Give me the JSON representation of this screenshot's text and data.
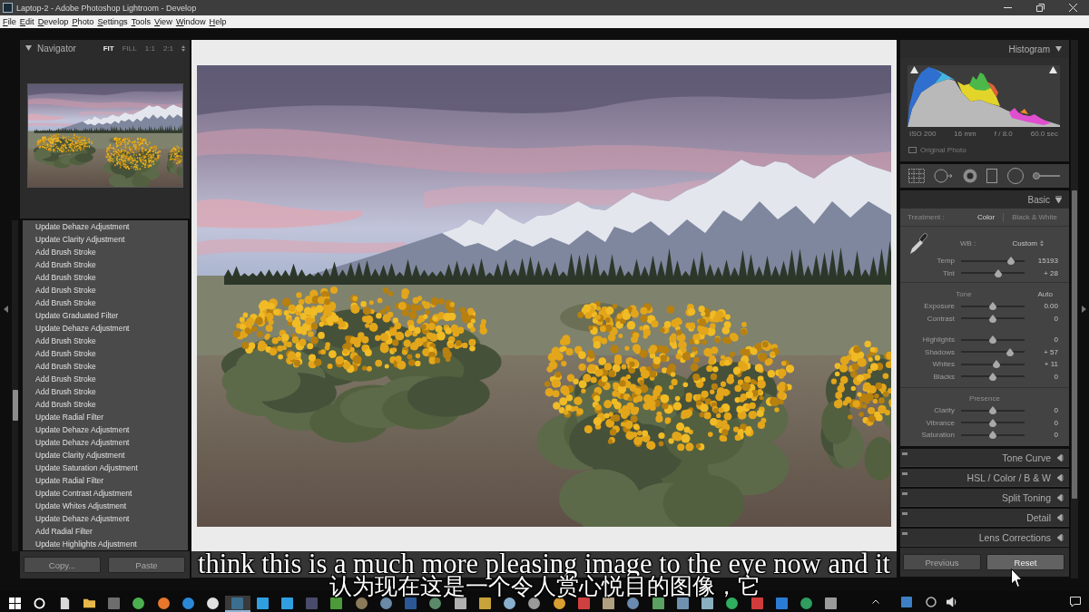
{
  "window": {
    "title": "Laptop-2 - Adobe Photoshop Lightroom - Develop"
  },
  "menu": [
    "File",
    "Edit",
    "Develop",
    "Photo",
    "Settings",
    "Tools",
    "View",
    "Window",
    "Help"
  ],
  "navigator": {
    "title": "Navigator",
    "zoom_options": [
      {
        "label": "FIT",
        "selected": true
      },
      {
        "label": "FILL",
        "selected": false
      },
      {
        "label": "1:1",
        "selected": false
      },
      {
        "label": "2:1",
        "selected": false
      }
    ]
  },
  "history": {
    "items": [
      "Update Dehaze Adjustment",
      "Update Clarity Adjustment",
      "Add Brush Stroke",
      "Add Brush Stroke",
      "Add Brush Stroke",
      "Add Brush Stroke",
      "Add Brush Stroke",
      "Update Graduated Filter",
      "Update Dehaze Adjustment",
      "Add Brush Stroke",
      "Add Brush Stroke",
      "Add Brush Stroke",
      "Add Brush Stroke",
      "Add Brush Stroke",
      "Add Brush Stroke",
      "Update Radial Filter",
      "Update Dehaze Adjustment",
      "Update Dehaze Adjustment",
      "Update Clarity Adjustment",
      "Update Saturation Adjustment",
      "Update Radial Filter",
      "Update Contrast Adjustment",
      "Update Whites Adjustment",
      "Update Dehaze Adjustment",
      "Add Radial Filter",
      "Update Highlights Adjustment"
    ]
  },
  "left_buttons": [
    "Copy...",
    "Paste"
  ],
  "histogram": {
    "title": "Histogram",
    "exif": [
      "ISO 200",
      "16 mm",
      "f / 8.0",
      "60.0 sec"
    ],
    "original_photo": {
      "label": "Original Photo",
      "checked": false
    }
  },
  "basic": {
    "title": "Basic",
    "treatment": {
      "label": "Treatment :",
      "options": [
        {
          "label": "Color",
          "selected": true
        },
        {
          "label": "Black & White",
          "selected": false
        }
      ]
    },
    "wb": {
      "label": "WB :",
      "value": "Custom"
    },
    "wb_sliders": [
      {
        "name": "Temp",
        "level": 0.78,
        "reading": "15193"
      },
      {
        "name": "Tint",
        "level": 0.59,
        "reading": "+ 28"
      }
    ],
    "tone": {
      "title": "Tone",
      "auto": "Auto",
      "groups": [
        [
          {
            "name": "Exposure",
            "level": 0.5,
            "reading": "0.00"
          },
          {
            "name": "Contrast",
            "level": 0.5,
            "reading": "0"
          }
        ],
        [
          {
            "name": "Highlights",
            "level": 0.5,
            "reading": "0"
          },
          {
            "name": "Shadows",
            "level": 0.77,
            "reading": "+ 57"
          },
          {
            "name": "Whites",
            "level": 0.55,
            "reading": "+ 11"
          },
          {
            "name": "Blacks",
            "level": 0.5,
            "reading": "0"
          }
        ]
      ]
    },
    "presence": {
      "title": "Presence",
      "sliders": [
        {
          "name": "Clarity",
          "level": 0.5,
          "reading": "0"
        },
        {
          "name": "Vibrance",
          "level": 0.5,
          "reading": "0"
        },
        {
          "name": "Saturation",
          "level": 0.5,
          "reading": "0"
        }
      ]
    }
  },
  "panels": [
    "Tone Curve",
    "HSL / Color / B & W",
    "Split Toning",
    "Detail",
    "Lens Corrections"
  ],
  "right_buttons": [
    {
      "label": "Previous",
      "hovered": false
    },
    {
      "label": "Reset",
      "hovered": true
    }
  ],
  "subtitles": [
    "think this is a much more pleasing image to the eye now and it",
    "认为现在这是一个令人赏心悦目的图像，它"
  ],
  "taskbar": {
    "apps": [
      {
        "kind": "start",
        "color": "#ffffff",
        "active": false
      },
      {
        "kind": "ring",
        "color": "#ffffff",
        "active": false
      },
      {
        "kind": "page",
        "color": "#d9d9d9",
        "active": false
      },
      {
        "kind": "folder",
        "color": "#e8b84a",
        "active": false
      },
      {
        "kind": "tile",
        "color": "#6d6d6d",
        "active": false
      },
      {
        "kind": "disc",
        "color": "#4caf50",
        "active": false
      },
      {
        "kind": "disc",
        "color": "#e8762b",
        "active": false
      },
      {
        "kind": "disc",
        "color": "#2b88d8",
        "active": false
      },
      {
        "kind": "disc",
        "color": "#e0e0e0",
        "active": false
      },
      {
        "kind": "tile",
        "color": "#3c6e8f",
        "active": true
      },
      {
        "kind": "tile",
        "color": "#2f9fe0",
        "active": false
      },
      {
        "kind": "tile",
        "color": "#2f9fe0",
        "active": false
      },
      {
        "kind": "tile",
        "color": "#4a4a6a",
        "active": false
      },
      {
        "kind": "tile",
        "color": "#4d9a3a",
        "active": false
      },
      {
        "kind": "disc",
        "color": "#8a7a5a",
        "active": false
      },
      {
        "kind": "disc",
        "color": "#6a8aa8",
        "active": false
      },
      {
        "kind": "tile",
        "color": "#2b5797",
        "active": false
      },
      {
        "kind": "disc",
        "color": "#5a8a6a",
        "active": false
      },
      {
        "kind": "tile",
        "color": "#b0b0b0",
        "active": false
      },
      {
        "kind": "tile",
        "color": "#c8a23a",
        "active": false
      },
      {
        "kind": "disc",
        "color": "#8ab0d0",
        "active": false
      },
      {
        "kind": "disc",
        "color": "#9a9a9a",
        "active": false
      },
      {
        "kind": "disc",
        "color": "#d9a030",
        "active": false
      },
      {
        "kind": "tile",
        "color": "#d04040",
        "active": false
      },
      {
        "kind": "tile",
        "color": "#b0a080",
        "active": false
      },
      {
        "kind": "disc",
        "color": "#6a8ab0",
        "active": false
      },
      {
        "kind": "tile",
        "color": "#5aa060",
        "active": false
      },
      {
        "kind": "tile",
        "color": "#7090b0",
        "active": false
      },
      {
        "kind": "tile",
        "color": "#8ab0c0",
        "active": false
      },
      {
        "kind": "disc",
        "color": "#2fae5e",
        "active": false
      },
      {
        "kind": "tile",
        "color": "#d23b3b",
        "active": false
      },
      {
        "kind": "tile",
        "color": "#2a7bd4",
        "active": false
      },
      {
        "kind": "disc",
        "color": "#2f9e5e",
        "active": false
      },
      {
        "kind": "tile",
        "color": "#9a9a9a",
        "active": false
      }
    ]
  }
}
